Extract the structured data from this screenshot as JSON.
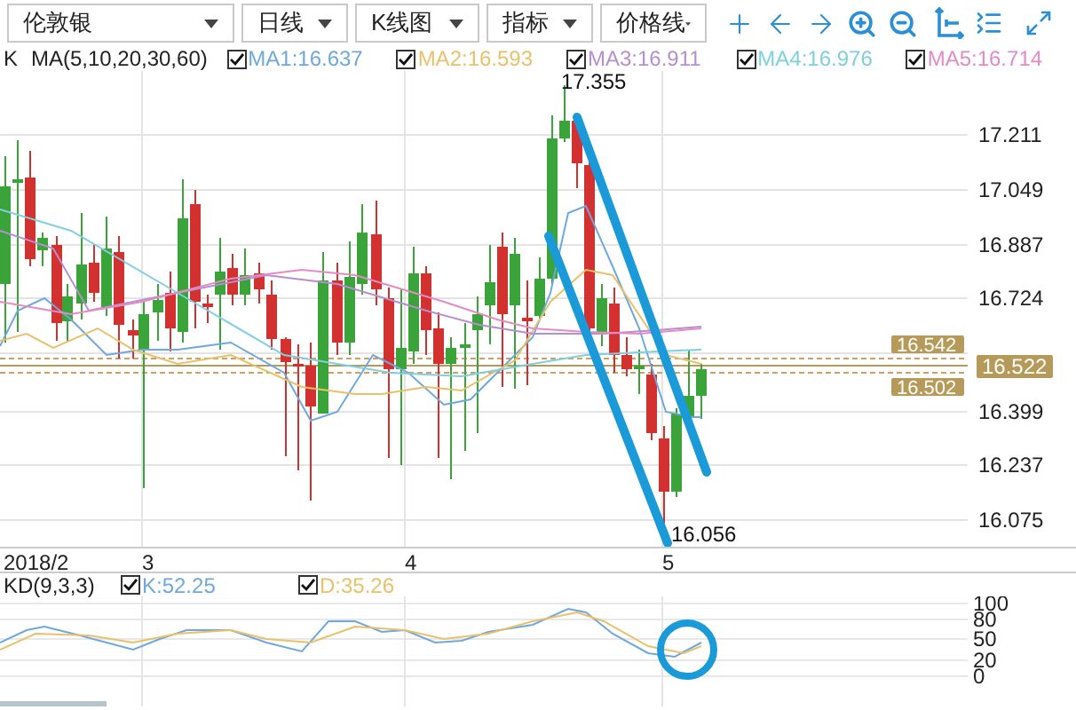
{
  "toolbar": {
    "selects": [
      {
        "value": "伦敦银"
      },
      {
        "value": "日线"
      },
      {
        "value": "K线图"
      },
      {
        "value": "指标"
      },
      {
        "value": "价格线"
      }
    ]
  },
  "legend": {
    "series_label": "K",
    "ma_label": "MA(5,10,20,30,60)",
    "items": [
      {
        "label": "MA1:16.637",
        "checked": true,
        "color": "#6fa8dc"
      },
      {
        "label": "MA2:16.593",
        "checked": true,
        "color": "#e8c16a"
      },
      {
        "label": "MA3:16.911",
        "checked": true,
        "color": "#b58fd0"
      },
      {
        "label": "MA4:16.976",
        "checked": true,
        "color": "#7fcfe0"
      },
      {
        "label": "MA5:16.714",
        "checked": true,
        "color": "#e38cc4"
      }
    ]
  },
  "price_chart": {
    "y_ticks": [
      "17.211",
      "17.049",
      "16.887",
      "16.724",
      "16.399",
      "16.237",
      "16.075"
    ],
    "high_label": "17.355",
    "low_label": "16.056",
    "price_tags": [
      {
        "text": "16.542",
        "kind": "chart"
      },
      {
        "text": "16.522",
        "kind": "axis"
      },
      {
        "text": "16.502",
        "kind": "chart"
      }
    ]
  },
  "date_axis": [
    "2018/2",
    "3",
    "4",
    "5"
  ],
  "kd": {
    "label": "KD(9,3,3)",
    "items": [
      {
        "label": "K:52.25",
        "checked": true,
        "color": "#6fa8dc"
      },
      {
        "label": "D:35.26",
        "checked": true,
        "color": "#e8c16a"
      }
    ],
    "y_ticks": [
      "100",
      "80",
      "50",
      "20",
      "0"
    ]
  }
}
